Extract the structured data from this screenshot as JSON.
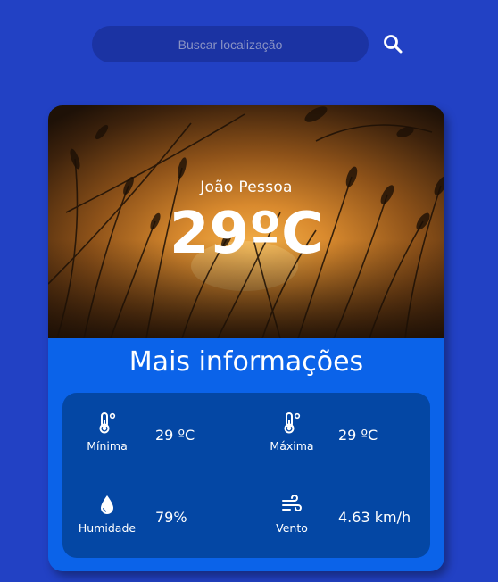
{
  "search": {
    "placeholder": "Buscar localização"
  },
  "weather": {
    "city": "João Pessoa",
    "temperature": "29ºC"
  },
  "details": {
    "title": "Mais informações",
    "min": {
      "label": "Mínima",
      "value": "29 ºC",
      "icon": "thermometer-icon"
    },
    "max": {
      "label": "Máxima",
      "value": "29 ºC",
      "icon": "thermometer-icon"
    },
    "humidity": {
      "label": "Humidade",
      "value": "79%",
      "icon": "water-drop-icon"
    },
    "wind": {
      "label": "Vento",
      "value": "4.63 km/h",
      "icon": "wind-icon"
    }
  },
  "colors": {
    "background": "#2241c4",
    "search_bg": "#1b33a3",
    "card_bg": "#0b63e9",
    "info_bg": "#0447a4"
  }
}
